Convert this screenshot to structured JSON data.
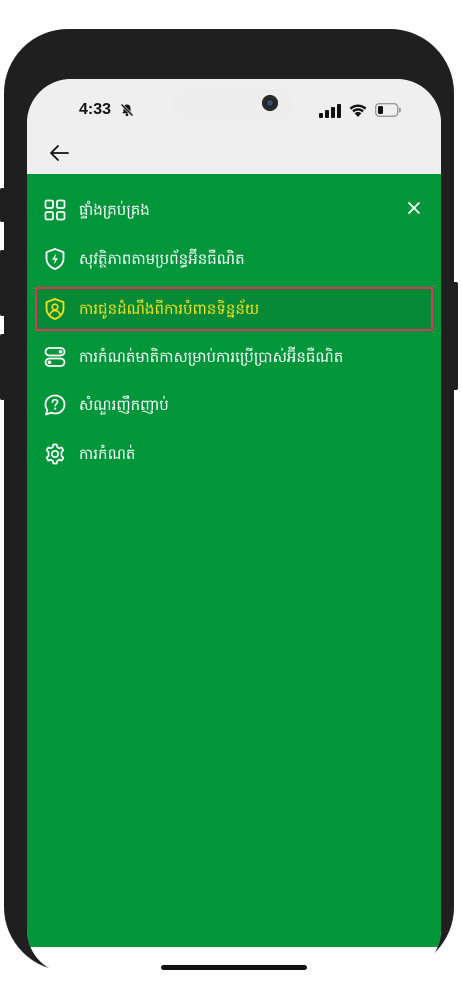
{
  "status_bar": {
    "time": "4:33",
    "icons": [
      "bell-slash-icon",
      "signal-icon",
      "wifi-icon",
      "battery-icon"
    ]
  },
  "header": {
    "back_icon": "arrow-left-icon"
  },
  "menu": {
    "close_icon": "close-icon",
    "active_index": 2,
    "items": [
      {
        "label": "ផ្ទាំងគ្រប់គ្រង",
        "icon": "dashboard-grid-icon"
      },
      {
        "label": "សុវត្ថិភាពតាមប្រព័ន្ធអ៊ីនធឺណិត",
        "icon": "shield-bolt-icon"
      },
      {
        "label": "ការជូនដំណឹងពីការបំពានទិន្នន័យ",
        "icon": "shield-user-icon"
      },
      {
        "label": "ការកំណត់មាតិកាសម្រាប់ការប្រើប្រាស់អ៊ីនធឺណិត",
        "icon": "toggle-settings-icon"
      },
      {
        "label": "សំណួរញឹកញាប់",
        "icon": "help-chat-icon"
      },
      {
        "label": "ការកំណត់",
        "icon": "gear-icon"
      }
    ]
  },
  "colors": {
    "panel_green": "#009639",
    "active_text": "#f5e11b",
    "active_border": "#d9365e",
    "status_bg": "#efefef"
  }
}
